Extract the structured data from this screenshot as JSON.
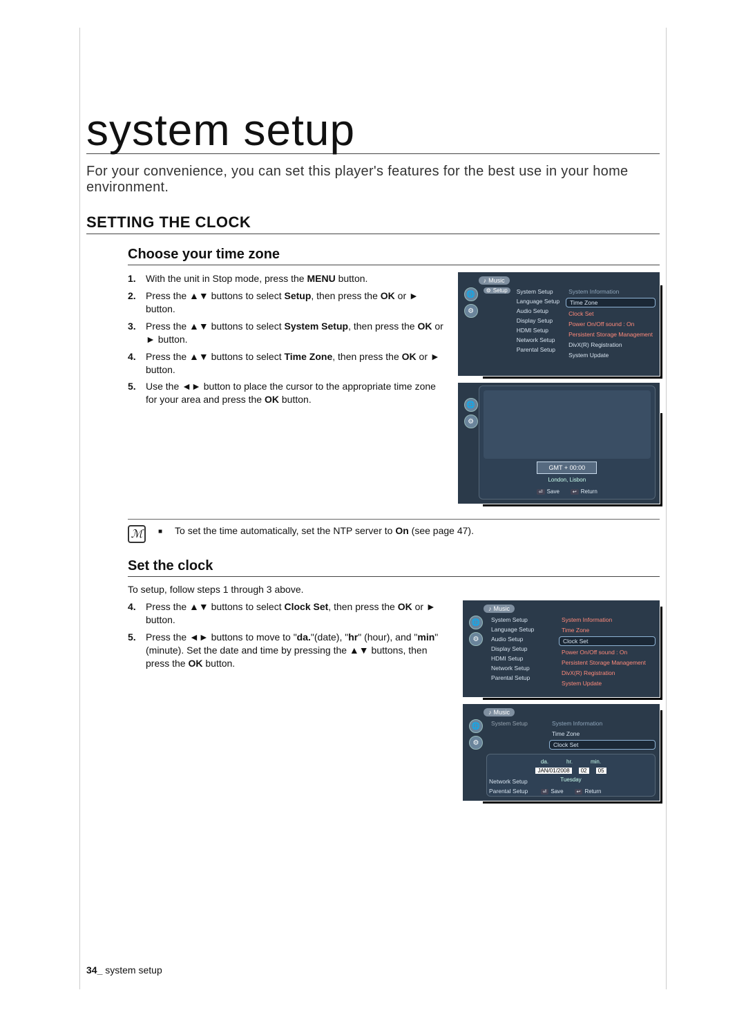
{
  "page": {
    "title": "system setup",
    "intro": "For your convenience, you can set this player's features for the best use in your home environment.",
    "footer_num": "34_",
    "footer_label": " system setup"
  },
  "h2": "SETTING THE CLOCK",
  "tz": {
    "heading": "Choose your time zone",
    "steps": [
      {
        "n": "1.",
        "a": "With the unit in Stop mode, press the ",
        "b": "MENU",
        "c": " button."
      },
      {
        "n": "2.",
        "a": "Press the ▲▼ buttons to select ",
        "b": "Setup",
        "c": ", then press the ",
        "d": "OK",
        "e": " or ► button."
      },
      {
        "n": "3.",
        "a": "Press the ▲▼ buttons to select ",
        "b": "System Setup",
        "c": ", then press the ",
        "d": "OK",
        "e": " or ► button."
      },
      {
        "n": "4.",
        "a": "Press the ▲▼ buttons to select ",
        "b": "Time Zone",
        "c": ", then press the ",
        "d": "OK",
        "e": " or ► button."
      },
      {
        "n": "5.",
        "a": "Use the ◄► button to place the cursor to the appropriate time zone for your area and press the ",
        "b": "OK",
        "c": " button."
      }
    ]
  },
  "note": {
    "dot": "■",
    "text_a": "To set the time automatically, set the NTP server to ",
    "text_b": "On",
    "text_c": " (see page 47)."
  },
  "clock": {
    "heading": "Set the clock",
    "lead": "To setup, follow steps 1 through 3 above.",
    "steps": [
      {
        "n": "4.",
        "a": "Press the ▲▼ buttons to select ",
        "b": "Clock Set",
        "c": ", then press the ",
        "d": "OK",
        "e": " or ► button."
      },
      {
        "n": "5.",
        "a": "Press the ◄► buttons to move to \"",
        "b": "da.",
        "c": "\"(date), \"",
        "d": "hr",
        "e": "\" (hour), and \"",
        "f": "min",
        "g": "\" (minute). Set the date and time by pressing the ▲▼ buttons, then press the ",
        "h": "OK",
        "i": " button."
      }
    ]
  },
  "osd": {
    "music": "Music",
    "setup": "Setup",
    "menu": [
      "System Setup",
      "Language Setup",
      "Audio Setup",
      "Display Setup",
      "HDMI Setup",
      "Network Setup",
      "Parental Setup"
    ],
    "panel": {
      "sys_info": "System Information",
      "time_zone": "Time Zone",
      "clock_set": "Clock Set",
      "power": "Power On/Off sound   :  On",
      "persist": "Persistent Storage Management",
      "divx": "DivX(R) Registration",
      "update": "System Update"
    },
    "map": {
      "gmt": "GMT + 00:00",
      "city": "London, Lisbon",
      "save": "Save",
      "return": "Return"
    },
    "clockvals": {
      "title": "Clock Set",
      "da": "da.",
      "hr": "hr.",
      "min": "min.",
      "date": "JAN/01/2008",
      "h": "02",
      "m": "05",
      "day": "Tuesday"
    }
  }
}
